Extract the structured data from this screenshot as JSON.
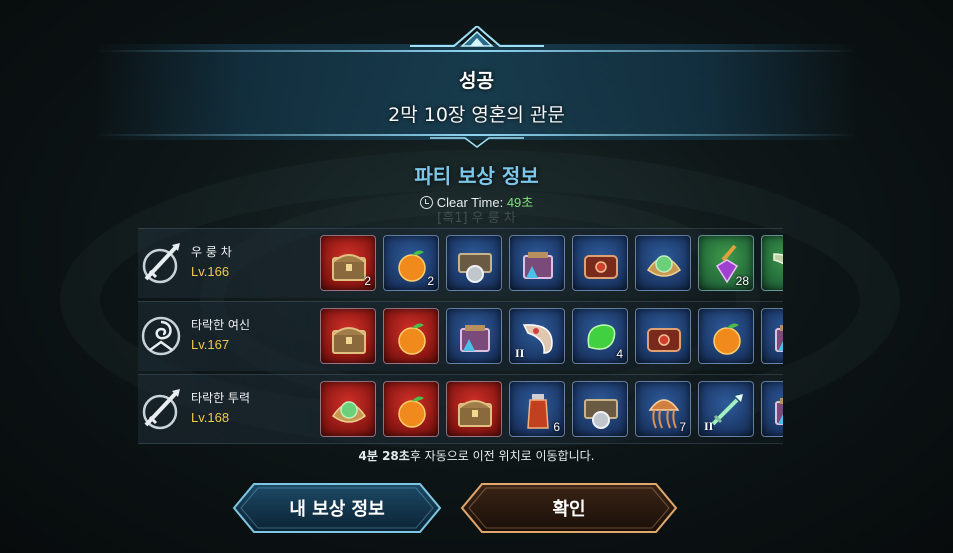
{
  "header": {
    "result": "성공",
    "stage": "2막 10장 영혼의 관문"
  },
  "party": {
    "title": "파티 보상 정보",
    "clear_label": "Clear Time:",
    "clear_value": "49초",
    "ghost_text": "[흑1] 우 룽 차"
  },
  "members": [
    {
      "name": "우 룽 차",
      "level": "Lv.166",
      "class_icon": "sword-emblem-icon",
      "items": [
        {
          "icon": "treasure-chest-icon",
          "color": "red",
          "count": "2",
          "grade": ""
        },
        {
          "icon": "orange-fruit-icon",
          "color": "blue",
          "count": "2",
          "grade": ""
        },
        {
          "icon": "coin-chest-icon",
          "color": "blue",
          "count": "",
          "grade": ""
        },
        {
          "icon": "crystal-box-icon",
          "color": "blue",
          "count": "",
          "grade": ""
        },
        {
          "icon": "red-chest-icon",
          "color": "blue",
          "count": "",
          "grade": ""
        },
        {
          "icon": "green-orb-icon",
          "color": "blue",
          "count": "",
          "grade": ""
        },
        {
          "icon": "purple-gem-icon",
          "color": "green",
          "count": "28",
          "grade": ""
        },
        {
          "icon": "horn-icon",
          "color": "green",
          "count": "",
          "grade": ""
        }
      ]
    },
    {
      "name": "타락한 여신",
      "level": "Lv.167",
      "class_icon": "spiral-emblem-icon",
      "items": [
        {
          "icon": "treasure-chest-icon",
          "color": "red",
          "count": "",
          "grade": ""
        },
        {
          "icon": "orange-fruit-icon",
          "color": "red",
          "count": "",
          "grade": ""
        },
        {
          "icon": "crystal-box-icon",
          "color": "blue",
          "count": "",
          "grade": ""
        },
        {
          "icon": "bone-horn-icon",
          "color": "blue",
          "count": "",
          "grade": "II"
        },
        {
          "icon": "green-slime-icon",
          "color": "blue",
          "count": "4",
          "grade": ""
        },
        {
          "icon": "red-chest-icon",
          "color": "blue",
          "count": "",
          "grade": ""
        },
        {
          "icon": "orange-fruit-icon",
          "color": "blue",
          "count": "",
          "grade": ""
        },
        {
          "icon": "crystal-box-icon",
          "color": "blue",
          "count": "",
          "grade": ""
        }
      ]
    },
    {
      "name": "타락한 투력",
      "level": "Lv.168",
      "class_icon": "sword-emblem-icon",
      "items": [
        {
          "icon": "green-orb-icon",
          "color": "red",
          "count": "",
          "grade": ""
        },
        {
          "icon": "orange-fruit-icon",
          "color": "red",
          "count": "",
          "grade": ""
        },
        {
          "icon": "treasure-chest-icon",
          "color": "red",
          "count": "",
          "grade": ""
        },
        {
          "icon": "potion-bottle-icon",
          "color": "blue",
          "count": "6",
          "grade": ""
        },
        {
          "icon": "coin-chest-icon",
          "color": "blue",
          "count": "",
          "grade": ""
        },
        {
          "icon": "jellyfish-icon",
          "color": "blue",
          "count": "7",
          "grade": ""
        },
        {
          "icon": "green-sword-icon",
          "color": "blue",
          "count": "",
          "grade": "II"
        },
        {
          "icon": "crystal-box-icon",
          "color": "blue",
          "count": "",
          "grade": ""
        }
      ]
    }
  ],
  "notice": {
    "time": "4분 28초",
    "text": "후 자동으로 이전 위치로 이동합니다."
  },
  "buttons": {
    "my_reward": "내 보상 정보",
    "confirm": "확인"
  },
  "colors": {
    "section_title": "#7cc8ea",
    "clear_value": "#7fe07a",
    "level": "#f2c94c",
    "slot_red": "#8a1612",
    "slot_blue": "#1b3766",
    "slot_green": "#23683a"
  }
}
